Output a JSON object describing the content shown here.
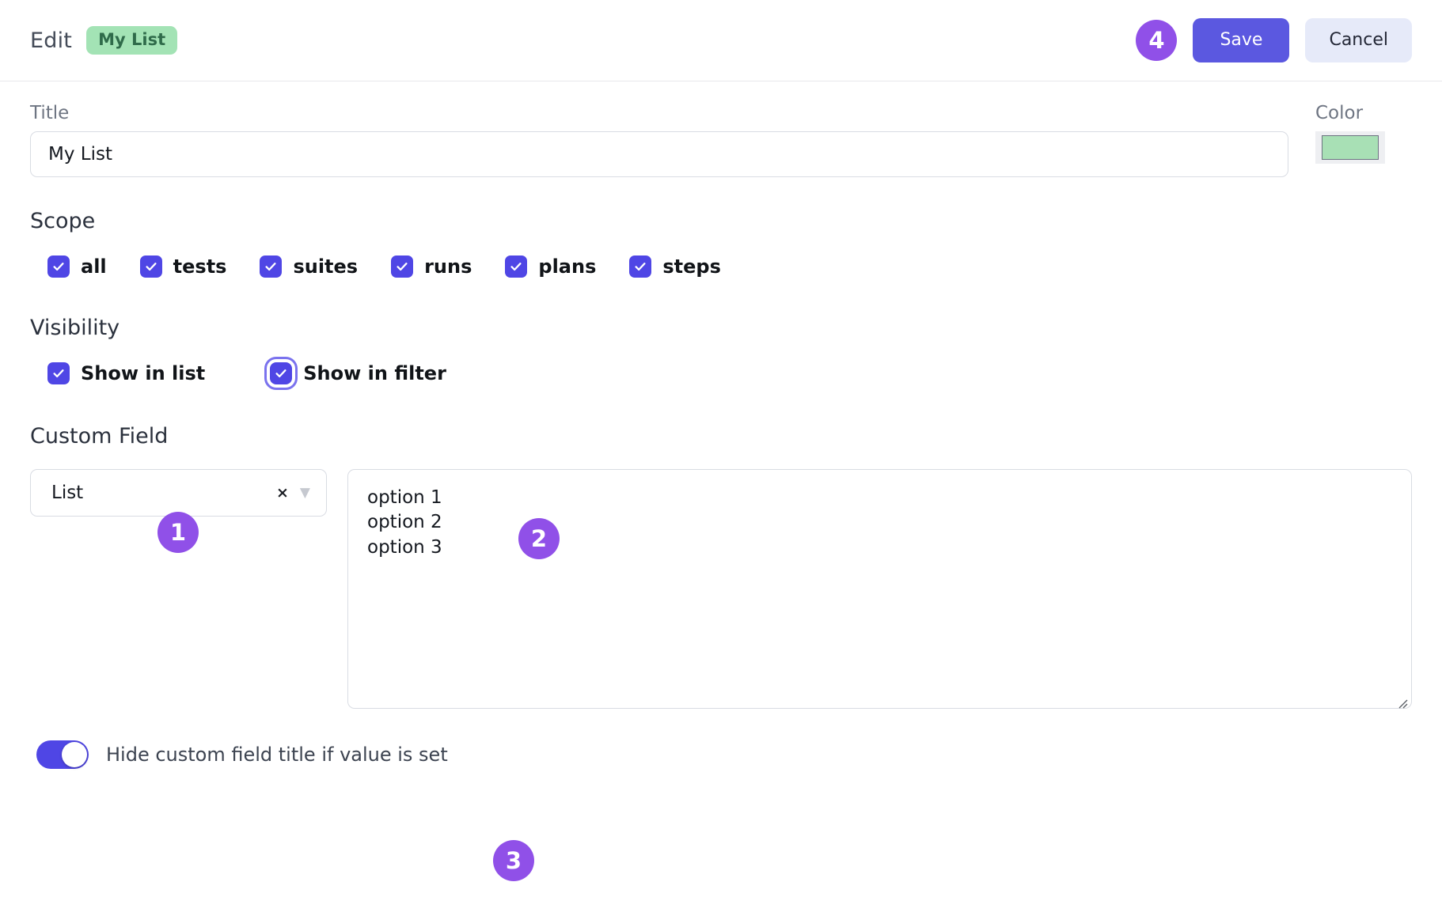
{
  "header": {
    "title": "Edit",
    "badge_label": "My List",
    "badge_bg": "#a3e3b5",
    "badge_fg": "#2f6b4a",
    "step_badge": "4",
    "save_label": "Save",
    "cancel_label": "Cancel",
    "save_bg": "#5b58e0",
    "cancel_bg": "#e6eaf9"
  },
  "title_field": {
    "label": "Title",
    "value": "My List",
    "placeholder": "Title"
  },
  "color_field": {
    "label": "Color",
    "value": "#a8e0b5"
  },
  "scope": {
    "heading": "Scope",
    "items": [
      {
        "label": "all",
        "checked": true
      },
      {
        "label": "tests",
        "checked": true
      },
      {
        "label": "suites",
        "checked": true
      },
      {
        "label": "runs",
        "checked": true
      },
      {
        "label": "plans",
        "checked": true
      },
      {
        "label": "steps",
        "checked": true
      }
    ]
  },
  "visibility": {
    "heading": "Visibility",
    "items": [
      {
        "label": "Show in list",
        "checked": true,
        "focused": false
      },
      {
        "label": "Show in filter",
        "checked": true,
        "focused": true
      }
    ]
  },
  "custom_field": {
    "heading": "Custom Field",
    "select_value": "List",
    "clear_icon": "×",
    "caret_icon": "▼",
    "options_value": "option 1\noption 2\noption 3",
    "options_placeholder": "",
    "options_lines": [
      "option 1",
      "option 2",
      "option 3"
    ]
  },
  "hide_title_toggle": {
    "label": "Hide custom field title if value is set",
    "enabled": true
  },
  "step_badges": {
    "one": "1",
    "two": "2",
    "three": "3",
    "color": "#9050e8"
  }
}
